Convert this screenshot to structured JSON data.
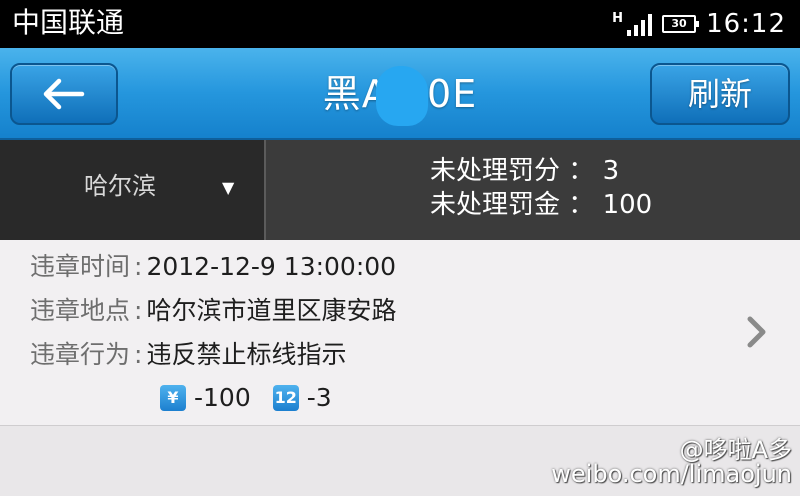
{
  "status_bar": {
    "carrier": "中国联通",
    "network": "H",
    "battery": "30",
    "time": "16:12"
  },
  "header": {
    "back_icon": "arrow-left-icon",
    "title": "黑A 00E",
    "refresh_label": "刷新"
  },
  "summary": {
    "city": "哈尔滨",
    "dropdown_icon": "triangle-down-icon",
    "points_label": "未处理罚分",
    "points_value": "3",
    "fine_label": "未处理罚金",
    "fine_value": "100"
  },
  "violation": {
    "time_label": "违章时间",
    "time_value": "2012-12-9 13:00:00",
    "place_label": "违章地点",
    "place_value": "哈尔滨市道里区康安路",
    "act_label": "违章行为",
    "act_value": "违反禁止标线指示",
    "fine_badge": "¥",
    "fine_value": "-100",
    "points_badge": "12",
    "points_value": "-3",
    "chevron_icon": "chevron-right-icon"
  },
  "watermark": {
    "name": "@哆啦A多",
    "url": "weibo.com/limaojun"
  },
  "colors": {
    "accent_blue": "#2596dd",
    "dark_bar": "#3b3b3b",
    "list_bg": "#f2f0f2"
  }
}
